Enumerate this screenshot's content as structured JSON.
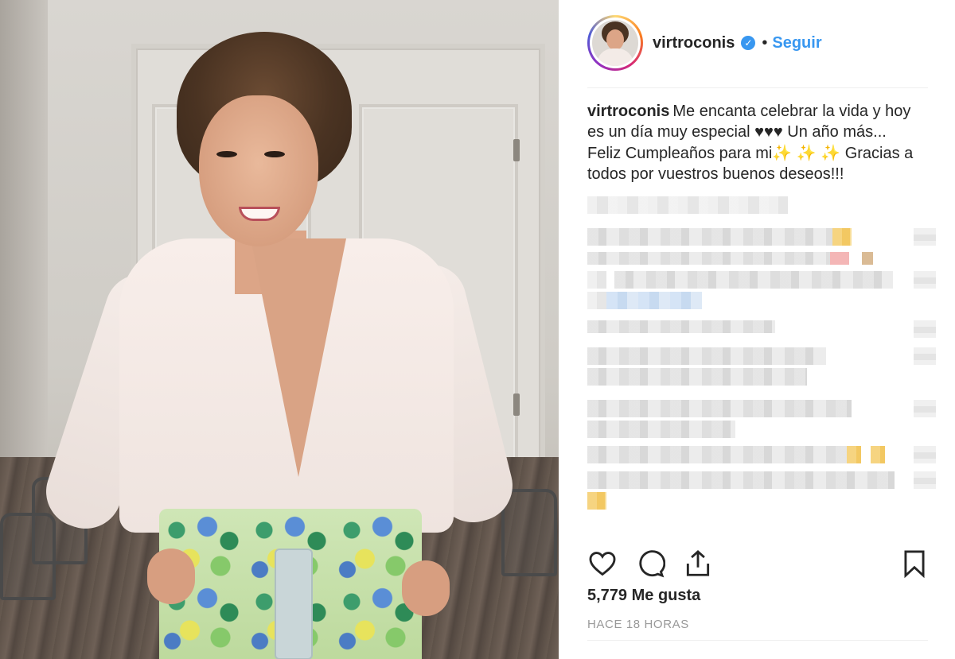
{
  "post": {
    "photo_description_icon": "photo-icon",
    "user": {
      "username": "virtroconis",
      "verified_icon": "verified-badge-icon",
      "separator": "•",
      "follow_label": "Seguir"
    },
    "caption": {
      "username": "virtroconis",
      "text": "Me encanta celebrar la vida y hoy es un día muy especial ♥♥♥ Un año más... Feliz Cumpleaños para mi✨ ✨ ✨ Gracias a todos por vuestros buenos deseos!!!"
    },
    "actions": {
      "like_icon": "heart-icon",
      "comment_icon": "comment-icon",
      "share_icon": "share-icon",
      "save_icon": "bookmark-icon"
    },
    "likes_text": "5,779 Me gusta",
    "timestamp": "HACE 18 HORAS",
    "colors": {
      "link_blue": "#3897f0",
      "text": "#262626",
      "muted": "#999999",
      "divider": "#efefef"
    }
  }
}
